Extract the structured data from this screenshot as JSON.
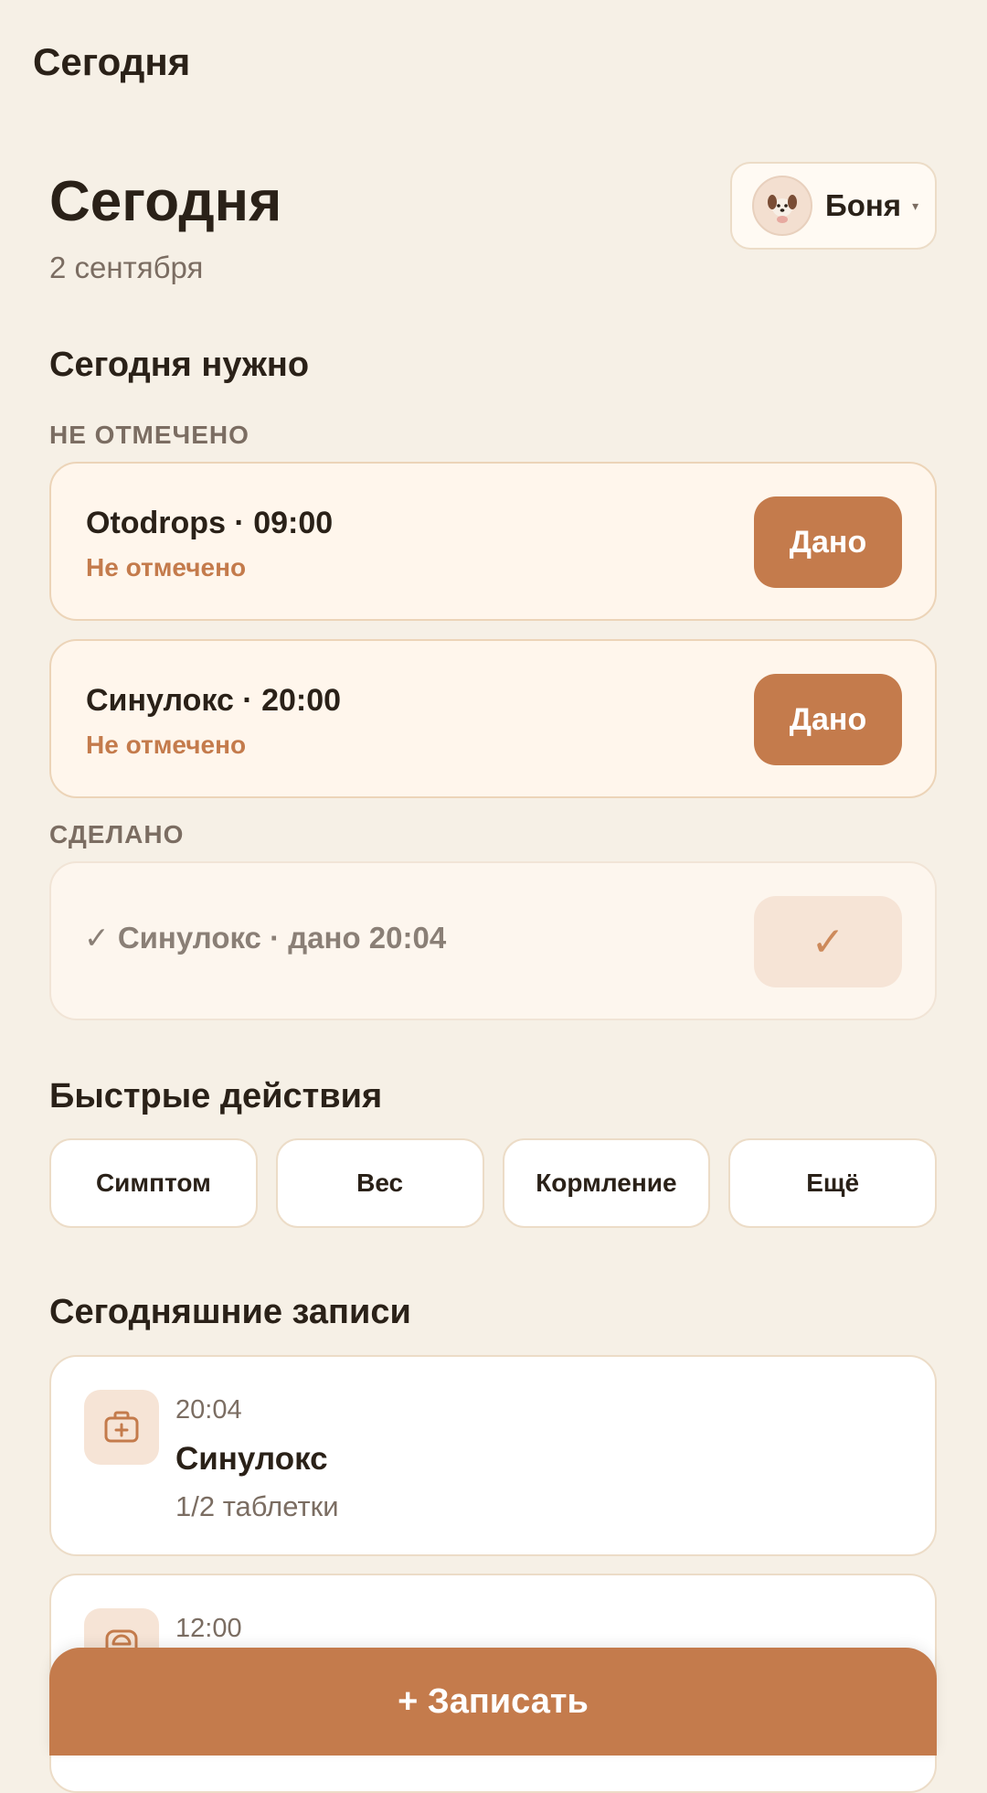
{
  "app_bar": {
    "title": "Сегодня"
  },
  "header": {
    "title": "Сегодня",
    "date": "2 сентября"
  },
  "pet_selector": {
    "name": "Боня",
    "caret": "▾",
    "avatar_icon": "dog-avatar"
  },
  "today_section": {
    "title": "Сегодня нужно",
    "pending_label": "НЕ ОТМЕЧЕНО",
    "pending": [
      {
        "name": "Otodrops · 09:00",
        "status": "Не отмечено",
        "button": "Дано"
      },
      {
        "name": "Синулокс · 20:00",
        "status": "Не отмечено",
        "button": "Дано"
      }
    ],
    "done_label": "СДЕЛАНО",
    "done": [
      {
        "text": "✓ Синулокс · дано 20:04",
        "button": "✓"
      }
    ]
  },
  "quick_actions": {
    "title": "Быстрые действия",
    "items": [
      "Симптом",
      "Вес",
      "Кормление",
      "Ещё"
    ]
  },
  "entries": {
    "title": "Сегодняшние записи",
    "items": [
      {
        "time": "20:04",
        "title": "Синулокс",
        "detail": "1/2 таблетки",
        "icon": "medkit-icon"
      },
      {
        "time": "12:00",
        "icon": "scale-icon"
      }
    ]
  },
  "fab": {
    "label": "+ Записать"
  },
  "colors": {
    "accent": "#c47b4c",
    "background": "#f6f0e6",
    "card_pending": "#fff6ec"
  }
}
